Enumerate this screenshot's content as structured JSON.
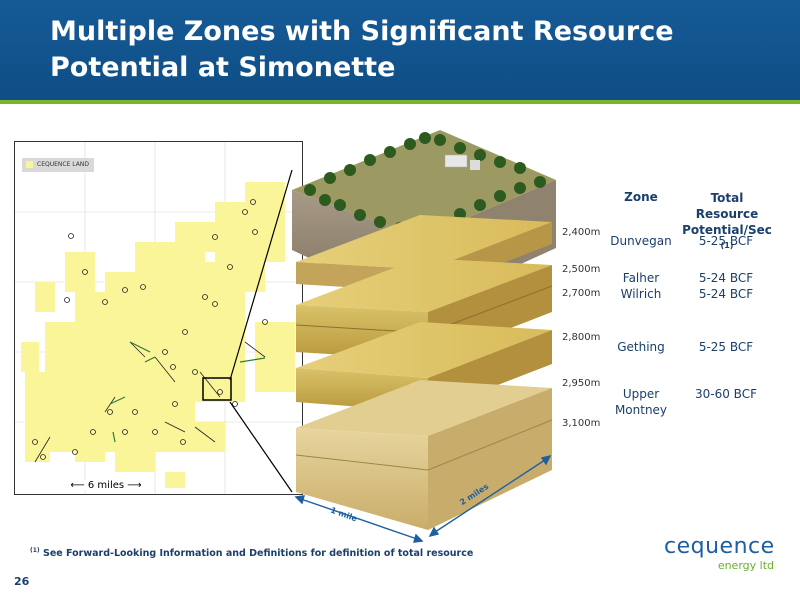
{
  "slide": {
    "title": "Multiple Zones with Significant Resource Potential at Simonette",
    "page_number": "26"
  },
  "map": {
    "legend_label": "CEQUENCE LAND",
    "scale_label": "6 miles",
    "colors": {
      "land": "#fbf59a",
      "grid": "#d0d0d0"
    }
  },
  "block": {
    "depths": [
      "2,400m",
      "2,500m",
      "2,700m",
      "2,800m",
      "2,950m",
      "3,100m"
    ],
    "dim_width": "1 mile",
    "dim_depth": "2 miles"
  },
  "table": {
    "headers": {
      "zone": "Zone",
      "resource": "Total Resource Potential/Sec",
      "resource_note": "(1)"
    },
    "rows": [
      {
        "zone": "Dunvegan",
        "value": "5-25 BCF"
      },
      {
        "zone": "Falher",
        "value": "5-24 BCF"
      },
      {
        "zone": "Wilrich",
        "value": "5-24 BCF"
      },
      {
        "zone": "Gething",
        "value": "5-25 BCF"
      },
      {
        "zone": "Upper Montney",
        "value": "30-60 BCF"
      }
    ]
  },
  "footnote": {
    "marker": "(1)",
    "text": "See Forward-Looking Information and Definitions for definition of total resource"
  },
  "logo": {
    "name": "cequence",
    "sub": "energy ltd"
  }
}
